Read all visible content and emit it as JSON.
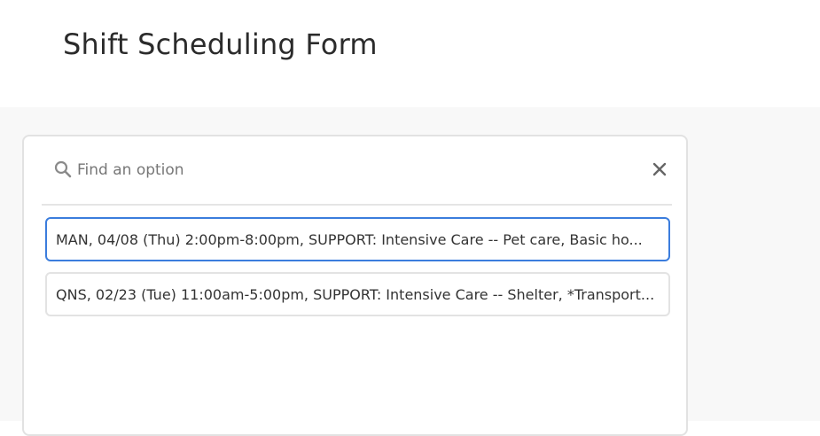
{
  "header": {
    "title": "Shift Scheduling Form"
  },
  "search": {
    "placeholder": "Find an option",
    "value": ""
  },
  "options": [
    {
      "label": "MAN, 04/08 (Thu) 2:00pm-8:00pm, SUPPORT: Intensive Care -- Pet care, Basic ho...",
      "selected": true
    },
    {
      "label": "QNS, 02/23 (Tue) 11:00am-5:00pm, SUPPORT: Intensive Care -- Shelter, *Transport...",
      "selected": false
    }
  ],
  "colors": {
    "selected_border": "#3b7ddd",
    "page_background": "#f8f8f8"
  },
  "icons": {
    "search": "search-icon",
    "close": "close-icon"
  }
}
